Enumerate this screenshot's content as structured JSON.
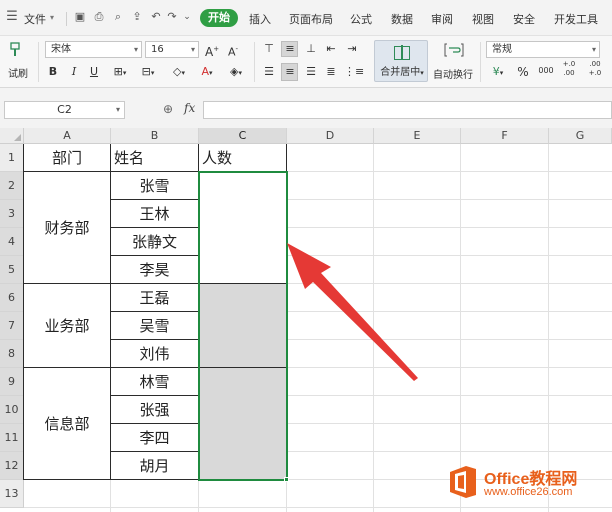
{
  "menu": {
    "file": "文件",
    "tabs": [
      "开始",
      "插入",
      "页面布局",
      "公式",
      "数据",
      "审阅",
      "视图",
      "安全",
      "开发工具"
    ]
  },
  "ribbon": {
    "paste_label": "试刷",
    "font_name": "宋体",
    "font_size": "16",
    "number_format": "常规",
    "merge_label": "合并居中",
    "wrap_label": "自动换行",
    "percent": "%",
    "thousands": "000",
    "inc_decimal": "+.0 .00",
    "dec_decimal": ".00 +.0"
  },
  "formula_bar": {
    "cell_ref": "C2",
    "fx": "fx",
    "formula": ""
  },
  "sheet": {
    "columns": [
      "A",
      "B",
      "C",
      "D",
      "E",
      "F",
      "G"
    ],
    "rows": [
      "1",
      "2",
      "3",
      "4",
      "5",
      "6",
      "7",
      "8",
      "9",
      "10",
      "11",
      "12",
      "13"
    ],
    "headers": {
      "dept": "部门",
      "name": "姓名",
      "count": "人数"
    },
    "departments": [
      "财务部",
      "业务部",
      "信息部"
    ],
    "names": [
      "张雪",
      "王林",
      "张静文",
      "李昊",
      "王磊",
      "吴雪",
      "刘伟",
      "林雪",
      "张强",
      "李四",
      "胡月"
    ]
  },
  "watermark": {
    "title": "Office教程网",
    "url": "www.office26.com"
  },
  "colors": {
    "accent": "#2f9e44",
    "selection": "#1f8b3f",
    "arrow": "#e53935",
    "watermark": "#e8601c"
  }
}
